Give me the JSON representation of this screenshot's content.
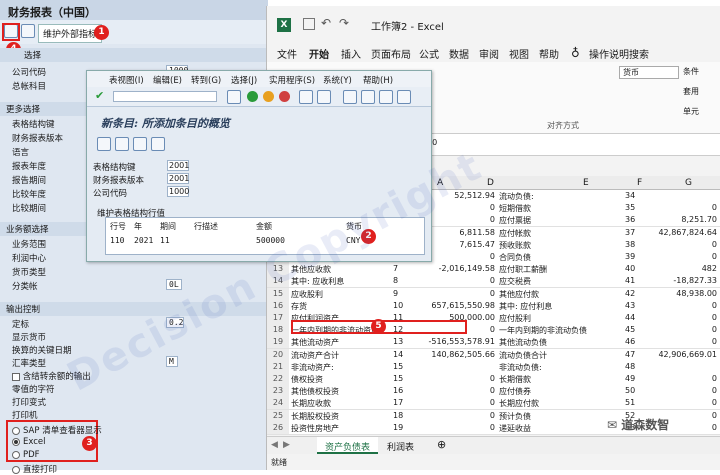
{
  "sap": {
    "title": "财务报表（中国）",
    "maint_button": "维护外部指标",
    "section1": "选择",
    "company_code_label": "公司代码",
    "company_code_value": "1000",
    "gl_account_label": "总帐科目",
    "section2": "更多选择",
    "fields2": [
      "表格结构键",
      "财务报表版本",
      "语言",
      "报表年度",
      "报告期间",
      "比较年度",
      "比较期间"
    ],
    "section3": "业务额选择",
    "fields3": [
      "业务范围",
      "利润中心",
      "货币类型",
      "分类帐"
    ],
    "ledger_value": "0L",
    "section4": "输出控制",
    "fields4": [
      "定标",
      "显示货币",
      "换算的关键日期",
      "汇率类型",
      "含结转余额的输出",
      "零值的字符",
      "打印变式",
      "打印机"
    ],
    "scale_value": "0.2",
    "rate_type_value": "M",
    "radio_sap": "SAP 清单查看器显示",
    "radio_excel": "Excel",
    "radio_pdf": "PDF",
    "radio_print": "直接打印"
  },
  "excel": {
    "title": "工作簿2 - Excel",
    "tabs": [
      "文件",
      "开始",
      "插入",
      "页面布局",
      "公式",
      "数据",
      "审阅",
      "视图",
      "帮助",
      "操作说明搜索"
    ],
    "number_format": "货币",
    "ribbon_group": "对齐方式",
    "ribbon_side": [
      "条件",
      "套用",
      "单元"
    ],
    "formula_value": "00",
    "col_headers": [
      "A",
      "C",
      "D",
      "E",
      "F",
      "G"
    ],
    "rows": [
      {
        "n": "",
        "a": "",
        "c": "",
        "d": "52,512.94",
        "e": "流动负债:",
        "f": "34",
        "g": ""
      },
      {
        "n": "",
        "a": "",
        "c": "",
        "d": "0",
        "e": "短期借款",
        "f": "35",
        "g": "0"
      },
      {
        "n": "",
        "a": "",
        "c": "",
        "d": "0",
        "e": "应付票据",
        "f": "36",
        "g": "8,251.70"
      },
      {
        "n": "",
        "a": "",
        "c": "",
        "d": "6,811.58",
        "e": "应付帐款",
        "f": "37",
        "g": "42,867,824.64"
      },
      {
        "n": "",
        "a": "",
        "c": "",
        "d": "7,615.47",
        "e": "预收账款",
        "f": "38",
        "g": "0"
      },
      {
        "n": "",
        "a": "",
        "c": "",
        "d": "0",
        "e": "合同负债",
        "f": "39",
        "g": "0"
      },
      {
        "n": "13",
        "a": "其他应收款",
        "c": "7",
        "d": "-2,016,149.58",
        "e": "应付职工薪酬",
        "f": "40",
        "g": "482"
      },
      {
        "n": "14",
        "a": "其中: 应收利息",
        "c": "8",
        "d": "0",
        "e": "应交税费",
        "f": "41",
        "g": "-18,827.33"
      },
      {
        "n": "15",
        "a": "应收股利",
        "c": "9",
        "d": "0",
        "e": "其他应付款",
        "f": "42",
        "g": "48,938.00"
      },
      {
        "n": "16",
        "a": "存货",
        "c": "10",
        "d": "657,615,550.98",
        "e": "其中: 应付利息",
        "f": "43",
        "g": "0"
      },
      {
        "n": "17",
        "a": "应付利润资产",
        "c": "11",
        "d": "500,000.00",
        "e": "应付股利",
        "f": "44",
        "g": "0"
      },
      {
        "n": "18",
        "a": "一年内到期的非流动资产",
        "c": "12",
        "d": "0",
        "e": "一年内到期的非流动负债",
        "f": "45",
        "g": "0"
      },
      {
        "n": "19",
        "a": "其他流动资产",
        "c": "13",
        "d": "-516,553,578.91",
        "e": "其他流动负债",
        "f": "46",
        "g": "0"
      },
      {
        "n": "20",
        "a": "流动资产合计",
        "c": "14",
        "d": "140,862,505.66",
        "e": "流动负债合计",
        "f": "47",
        "g": "42,906,669.01"
      },
      {
        "n": "21",
        "a": "非流动资产:",
        "c": "15",
        "d": "",
        "e": "非流动负债:",
        "f": "48",
        "g": ""
      },
      {
        "n": "22",
        "a": "债权投资",
        "c": "15",
        "d": "0",
        "e": "长期借款",
        "f": "49",
        "g": "0"
      },
      {
        "n": "23",
        "a": "其他债权投资",
        "c": "16",
        "d": "0",
        "e": "应付债券",
        "f": "50",
        "g": "0"
      },
      {
        "n": "24",
        "a": "长期应收款",
        "c": "17",
        "d": "0",
        "e": "长期应付款",
        "f": "51",
        "g": "0"
      },
      {
        "n": "25",
        "a": "长期股权投资",
        "c": "18",
        "d": "0",
        "e": "预计负债",
        "f": "52",
        "g": "0"
      },
      {
        "n": "26",
        "a": "投资性房地产",
        "c": "19",
        "d": "0",
        "e": "递延收益",
        "f": "53",
        "g": "0"
      }
    ],
    "sheet_tabs": [
      "资产负债表",
      "利润表"
    ],
    "status": "就绪"
  },
  "dialog": {
    "menu": [
      "表视图(I)",
      "编辑(E)",
      "转到(G)",
      "选择(J)",
      "实用程序(S)",
      "系统(Y)",
      "帮助(H)"
    ],
    "title": "新条目: 所添加条目的概览",
    "labels": [
      "表格结构键",
      "财务报表版本",
      "公司代码"
    ],
    "values": [
      "2001",
      "2001",
      "1000"
    ],
    "table_title": "维护表格结构行值",
    "columns": [
      "行号",
      "年",
      "期间",
      "行描述",
      "金额",
      "货币"
    ],
    "row": [
      "110",
      "2021",
      "11",
      "",
      "500000",
      "CNY"
    ]
  },
  "callouts": [
    "1",
    "2",
    "3",
    "4",
    "5"
  ],
  "watermark": "Decision Copyright",
  "wechat": "道森数智"
}
